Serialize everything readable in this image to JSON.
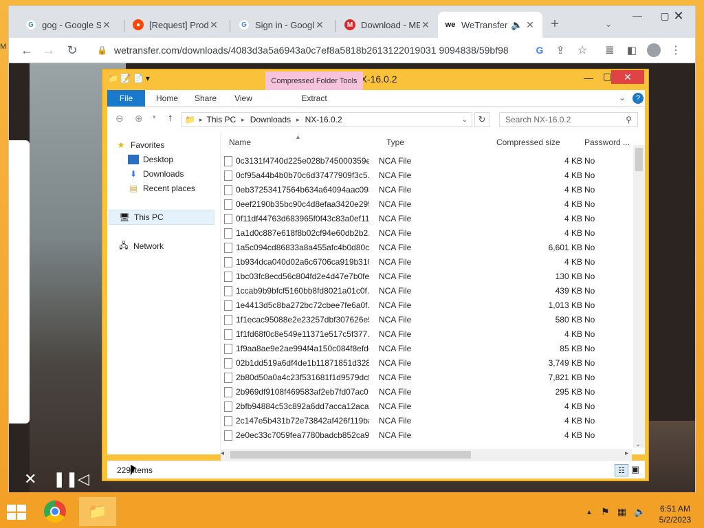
{
  "browser": {
    "tabs": [
      {
        "title": "gog - Google Se",
        "favicon": "google-icon"
      },
      {
        "title": "[Request] Prod",
        "favicon": "reddit-icon"
      },
      {
        "title": "Sign in - Google",
        "favicon": "google-icon"
      },
      {
        "title": "Download - ME",
        "favicon": "mega-icon"
      },
      {
        "title": "WeTransfer",
        "favicon": "wetransfer-icon"
      }
    ],
    "new_tab": "+",
    "url": "wetransfer.com/downloads/4083d3a5a6943a0c7ef8a5818b2613122019031 9094838/59bf98"
  },
  "explorer": {
    "title": "NX-16.0.2",
    "contextual_tab": "Compressed Folder Tools",
    "ribbon_tabs": [
      "File",
      "Home",
      "Share",
      "View"
    ],
    "extract_tab": "Extract",
    "breadcrumb": [
      "This PC",
      "Downloads",
      "NX-16.0.2"
    ],
    "search_placeholder": "Search NX-16.0.2",
    "nav": {
      "favorites": "Favorites",
      "desktop": "Desktop",
      "downloads": "Downloads",
      "recent": "Recent places",
      "thispc": "This PC",
      "network": "Network"
    },
    "columns": {
      "name": "Name",
      "type": "Type",
      "size": "Compressed size",
      "password": "Password ..."
    },
    "files": [
      {
        "name": "0c3131f4740d225e028b745000359e...",
        "type": "NCA File",
        "size": "4 KB",
        "password": "No"
      },
      {
        "name": "0cf95a44b4b0b70c6d37477909f3c5...",
        "type": "NCA File",
        "size": "4 KB",
        "password": "No"
      },
      {
        "name": "0eb37253417564b634a64094aac093...",
        "type": "NCA File",
        "size": "4 KB",
        "password": "No"
      },
      {
        "name": "0eef2190b35bc90c4d8efaa3420e295...",
        "type": "NCA File",
        "size": "4 KB",
        "password": "No"
      },
      {
        "name": "0f11df44763d683965f0f43c83a0ef11...",
        "type": "NCA File",
        "size": "4 KB",
        "password": "No"
      },
      {
        "name": "1a1d0c887e618f8b02cf94e60db2b2...",
        "type": "NCA File",
        "size": "4 KB",
        "password": "No"
      },
      {
        "name": "1a5c094cd86833a8a455afc4b0d80c...",
        "type": "NCA File",
        "size": "6,601 KB",
        "password": "No"
      },
      {
        "name": "1b934dca040d02a6c6706ca919b310...",
        "type": "NCA File",
        "size": "4 KB",
        "password": "No"
      },
      {
        "name": "1bc03fc8ecd56c804fd2e4d47e7b0fe...",
        "type": "NCA File",
        "size": "130 KB",
        "password": "No"
      },
      {
        "name": "1ccab9b9bfcf5160bb8fd8021a01c0f...",
        "type": "NCA File",
        "size": "439 KB",
        "password": "No"
      },
      {
        "name": "1e4413d5c8ba272bc72cbee7fe6a0f...",
        "type": "NCA File",
        "size": "1,013 KB",
        "password": "No"
      },
      {
        "name": "1f1ecac95088e2e23257dbf307626e5...",
        "type": "NCA File",
        "size": "580 KB",
        "password": "No"
      },
      {
        "name": "1f1fd68f0c8e549e11371e517c5f377...",
        "type": "NCA File",
        "size": "4 KB",
        "password": "No"
      },
      {
        "name": "1f9aa8ae9e2ae994f4a150c084f8efde...",
        "type": "NCA File",
        "size": "85 KB",
        "password": "No"
      },
      {
        "name": "02b1dd519a6df4de1b11871851d328...",
        "type": "NCA File",
        "size": "3,749 KB",
        "password": "No"
      },
      {
        "name": "2b80d50a0a4c23f531681f1d9579dcf...",
        "type": "NCA File",
        "size": "7,821 KB",
        "password": "No"
      },
      {
        "name": "2b969df9108f469583af2eb7fd07ac0...",
        "type": "NCA File",
        "size": "295 KB",
        "password": "No"
      },
      {
        "name": "2bfb94884c53c892a6dd7acca12aca...",
        "type": "NCA File",
        "size": "4 KB",
        "password": "No"
      },
      {
        "name": "2c147e5b431b72e73842af426f119ba...",
        "type": "NCA File",
        "size": "4 KB",
        "password": "No"
      },
      {
        "name": "2e0ec33c7059fea7780badcb852ca9...",
        "type": "NCA File",
        "size": "4 KB",
        "password": "No"
      }
    ],
    "status": "229 items"
  },
  "taskbar": {
    "time": "6:51 AM",
    "date": "5/2/2023"
  }
}
